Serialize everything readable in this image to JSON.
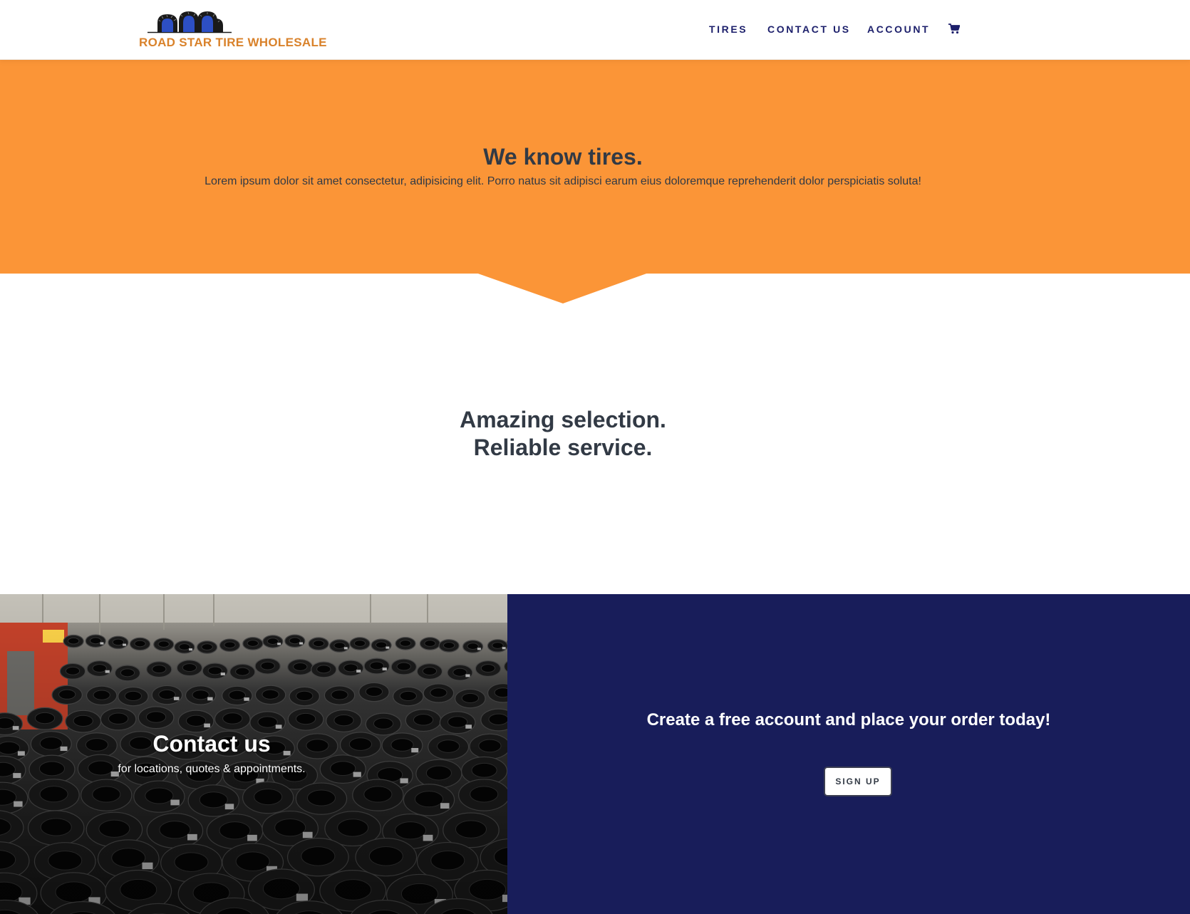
{
  "colors": {
    "brand_orange": "#fb9537",
    "logo_text_orange": "#d9822b",
    "navy": "#181d5a",
    "nav_text": "#1c1f6b",
    "heading_dark": "#323a45",
    "white": "#ffffff"
  },
  "header": {
    "logo_text": "ROAD STAR TIRE WHOLESALE",
    "logo_icon": "tires-logo-icon",
    "nav": {
      "tires": "TIRES",
      "contact": "CONTACT US",
      "account": "ACCOUNT",
      "cart_icon": "shopping-cart-icon"
    }
  },
  "hero": {
    "title": "We know tires.",
    "subtitle": "Lorem ipsum dolor sit amet consectetur, adipisicing elit. Porro natus sit adipisci earum eius doloremque reprehenderit dolor perspiciatis soluta!"
  },
  "tagline": {
    "line1": "Amazing selection.",
    "line2": "Reliable service."
  },
  "contact_panel": {
    "title": "Contact us",
    "subtitle": "for locations, quotes & appointments."
  },
  "signup_panel": {
    "title": "Create a free account and place your order today!",
    "button_label": "SIGN UP"
  }
}
